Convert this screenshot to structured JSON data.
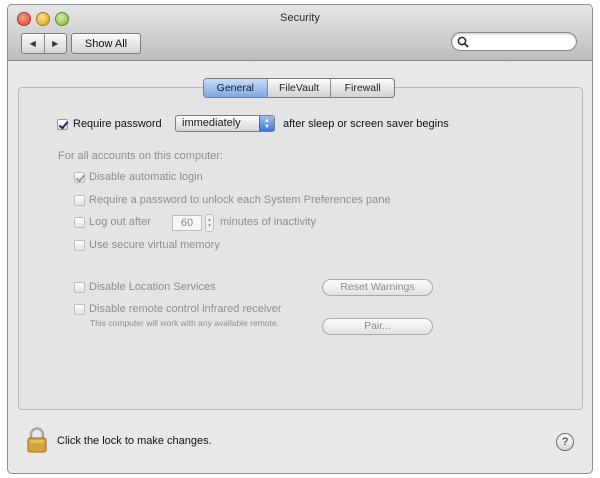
{
  "window": {
    "title": "Security"
  },
  "toolbar": {
    "back_glyph": "◀",
    "forward_glyph": "▶",
    "show_all_label": "Show All",
    "search": {
      "value": "",
      "placeholder": ""
    }
  },
  "tabs": [
    {
      "label": "General",
      "selected": true
    },
    {
      "label": "FileVault",
      "selected": false
    },
    {
      "label": "Firewall",
      "selected": false
    }
  ],
  "general": {
    "require_password": {
      "checked": true,
      "label": "Require password",
      "popup_value": "immediately",
      "suffix": "after sleep or screen saver begins"
    },
    "all_accounts_heading": "For all accounts on this computer:",
    "options": {
      "disable_auto_login": {
        "label": "Disable automatic login",
        "checked": true,
        "enabled": false
      },
      "require_pref_password": {
        "label": "Require a password to unlock each System Preferences pane",
        "checked": false,
        "enabled": false
      },
      "log_out_after": {
        "label": "Log out after",
        "value": "60",
        "suffix": "minutes of inactivity",
        "checked": false,
        "enabled": false
      },
      "secure_vm": {
        "label": "Use secure virtual memory",
        "checked": false,
        "enabled": false
      },
      "disable_location": {
        "label": "Disable Location Services",
        "checked": false,
        "enabled": false
      },
      "disable_ir": {
        "label": "Disable remote control infrared receiver",
        "checked": false,
        "enabled": false
      }
    },
    "ir_note": "This computer will work with any available remote.",
    "reset_warnings_label": "Reset Warnings",
    "pair_label": "Pair..."
  },
  "footer": {
    "lock_label": "Click the lock to make changes.",
    "help_label": "?"
  },
  "colors": {
    "tab_selected": "#7ea8e2",
    "disabled_text": "#8e8e8e",
    "lock": "#d9a23a"
  },
  "icons": [
    "search-icon",
    "lock-icon",
    "chevron-updown-icon",
    "back-arrow-icon",
    "forward-arrow-icon",
    "help-icon"
  ]
}
